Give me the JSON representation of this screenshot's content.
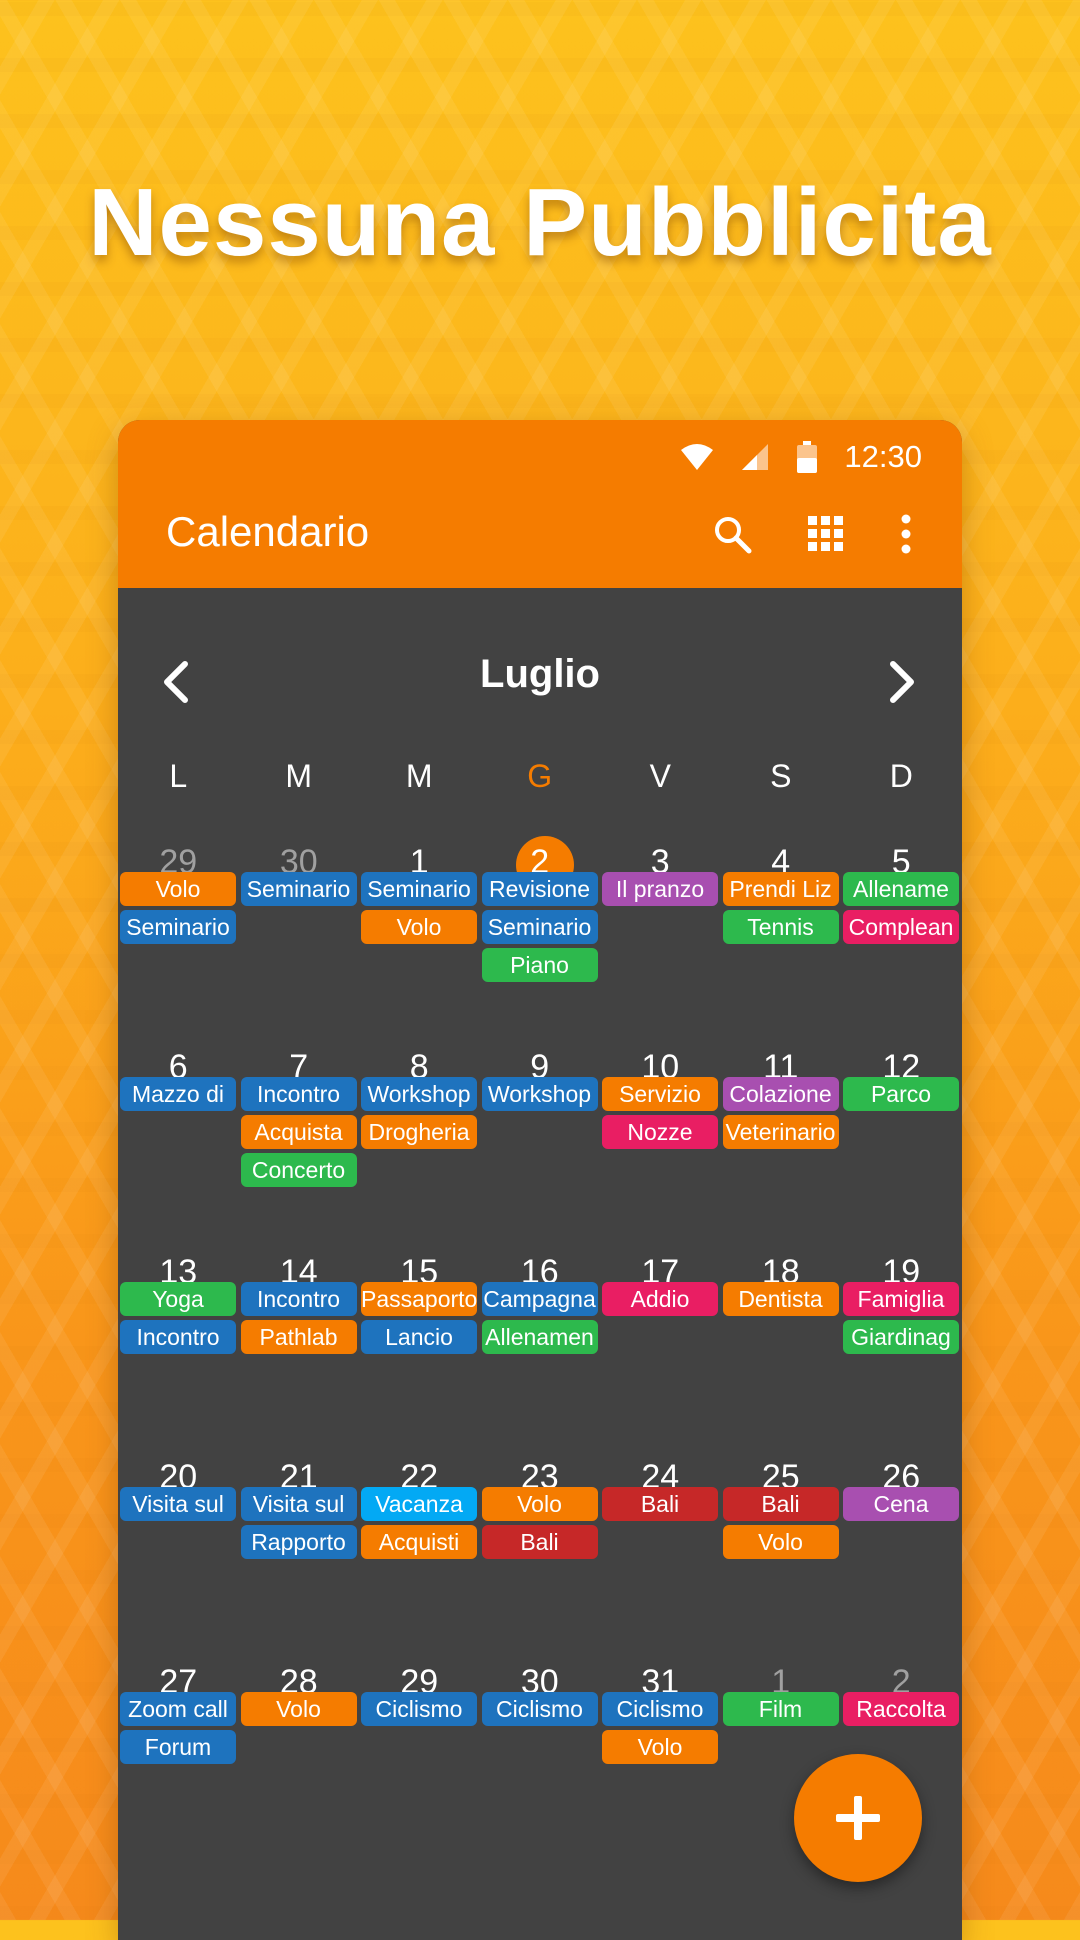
{
  "headline": "Nessuna Pubblicita",
  "status_bar": {
    "time": "12:30",
    "icons": [
      "wifi-icon",
      "signal-icon",
      "battery-icon"
    ]
  },
  "toolbar": {
    "title": "Calendario",
    "actions": [
      "search-icon",
      "grid-view-icon",
      "more-vert-icon"
    ]
  },
  "month_nav": {
    "title": "Luglio",
    "prev": "chevron-left-icon",
    "next": "chevron-right-icon"
  },
  "weekdays": [
    "L",
    "M",
    "M",
    "G",
    "V",
    "S",
    "D"
  ],
  "today_weekday_index": 3,
  "colors": {
    "orange": "#F57C00",
    "blue": "#1E73BE",
    "green": "#2DB94D",
    "purple": "#A84FB0",
    "pink": "#E91E63",
    "red": "#C62828",
    "cyan": "#03A9F4"
  },
  "weeks": [
    [
      {
        "day": "29",
        "other": true,
        "events": [
          {
            "t": "Volo",
            "c": "orange"
          },
          {
            "t": "Seminario",
            "c": "blue"
          }
        ]
      },
      {
        "day": "30",
        "other": true,
        "events": [
          {
            "t": "Seminario",
            "c": "blue"
          }
        ]
      },
      {
        "day": "1",
        "events": [
          {
            "t": "Seminario",
            "c": "blue"
          },
          {
            "t": "Volo",
            "c": "orange"
          }
        ]
      },
      {
        "day": "2",
        "today": true,
        "events": [
          {
            "t": "Revisione",
            "c": "blue"
          },
          {
            "t": "Seminario",
            "c": "blue"
          },
          {
            "t": "Piano",
            "c": "green"
          }
        ]
      },
      {
        "day": "3",
        "events": [
          {
            "t": "Il pranzo",
            "c": "purple"
          }
        ]
      },
      {
        "day": "4",
        "events": [
          {
            "t": "Prendi Liz",
            "c": "orange"
          },
          {
            "t": "Tennis",
            "c": "green"
          }
        ]
      },
      {
        "day": "5",
        "events": [
          {
            "t": "Allename",
            "c": "green"
          },
          {
            "t": "Complean",
            "c": "pink"
          }
        ]
      }
    ],
    [
      {
        "day": "6",
        "events": [
          {
            "t": "Mazzo di",
            "c": "blue"
          }
        ]
      },
      {
        "day": "7",
        "events": [
          {
            "t": "Incontro",
            "c": "blue"
          },
          {
            "t": "Acquista",
            "c": "orange"
          },
          {
            "t": "Concerto",
            "c": "green"
          }
        ]
      },
      {
        "day": "8",
        "events": [
          {
            "t": "Workshop",
            "c": "blue"
          },
          {
            "t": "Drogheria",
            "c": "orange"
          }
        ]
      },
      {
        "day": "9",
        "events": [
          {
            "t": "Workshop",
            "c": "blue"
          }
        ]
      },
      {
        "day": "10",
        "events": [
          {
            "t": "Servizio",
            "c": "orange"
          },
          {
            "t": "Nozze",
            "c": "pink"
          }
        ]
      },
      {
        "day": "11",
        "events": [
          {
            "t": "Colazione",
            "c": "purple"
          },
          {
            "t": "Veterinario",
            "c": "orange"
          }
        ]
      },
      {
        "day": "12",
        "events": [
          {
            "t": "Parco",
            "c": "green"
          }
        ]
      }
    ],
    [
      {
        "day": "13",
        "events": [
          {
            "t": "Yoga",
            "c": "green"
          },
          {
            "t": "Incontro",
            "c": "blue"
          }
        ]
      },
      {
        "day": "14",
        "events": [
          {
            "t": "Incontro",
            "c": "blue"
          },
          {
            "t": "Pathlab",
            "c": "orange"
          }
        ]
      },
      {
        "day": "15",
        "events": [
          {
            "t": "Passaporto",
            "c": "orange"
          },
          {
            "t": "Lancio",
            "c": "blue"
          }
        ]
      },
      {
        "day": "16",
        "events": [
          {
            "t": "Campagna",
            "c": "blue"
          },
          {
            "t": "Allenamen",
            "c": "green"
          }
        ]
      },
      {
        "day": "17",
        "events": [
          {
            "t": "Addio",
            "c": "pink"
          }
        ]
      },
      {
        "day": "18",
        "events": [
          {
            "t": "Dentista",
            "c": "orange"
          }
        ]
      },
      {
        "day": "19",
        "events": [
          {
            "t": "Famiglia",
            "c": "pink"
          },
          {
            "t": "Giardinag",
            "c": "green"
          }
        ]
      }
    ],
    [
      {
        "day": "20",
        "events": [
          {
            "t": "Visita sul",
            "c": "blue"
          }
        ]
      },
      {
        "day": "21",
        "events": [
          {
            "t": "Visita sul",
            "c": "blue"
          },
          {
            "t": "Rapporto",
            "c": "blue"
          }
        ]
      },
      {
        "day": "22",
        "events": [
          {
            "t": "Vacanza",
            "c": "cyan"
          },
          {
            "t": "Acquisti",
            "c": "orange"
          }
        ]
      },
      {
        "day": "23",
        "events": [
          {
            "t": "Volo",
            "c": "orange"
          },
          {
            "t": "Bali",
            "c": "red"
          }
        ]
      },
      {
        "day": "24",
        "events": [
          {
            "t": "Bali",
            "c": "red"
          }
        ]
      },
      {
        "day": "25",
        "events": [
          {
            "t": "Bali",
            "c": "red"
          },
          {
            "t": "Volo",
            "c": "orange"
          }
        ]
      },
      {
        "day": "26",
        "events": [
          {
            "t": "Cena",
            "c": "purple"
          }
        ]
      }
    ],
    [
      {
        "day": "27",
        "events": [
          {
            "t": "Zoom call",
            "c": "blue"
          },
          {
            "t": "Forum",
            "c": "blue"
          }
        ]
      },
      {
        "day": "28",
        "events": [
          {
            "t": "Volo",
            "c": "orange"
          }
        ]
      },
      {
        "day": "29",
        "events": [
          {
            "t": "Ciclismo",
            "c": "blue"
          }
        ]
      },
      {
        "day": "30",
        "events": [
          {
            "t": "Ciclismo",
            "c": "blue"
          }
        ]
      },
      {
        "day": "31",
        "events": [
          {
            "t": "Ciclismo",
            "c": "blue"
          },
          {
            "t": "Volo",
            "c": "orange"
          }
        ]
      },
      {
        "day": "1",
        "other": true,
        "events": [
          {
            "t": "Film",
            "c": "green"
          }
        ]
      },
      {
        "day": "2",
        "other": true,
        "events": [
          {
            "t": "Raccolta",
            "c": "pink"
          }
        ]
      }
    ]
  ],
  "fab": {
    "icon": "plus-icon"
  }
}
